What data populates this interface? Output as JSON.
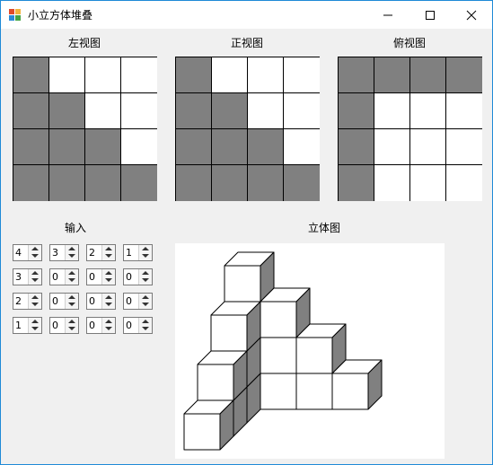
{
  "window": {
    "title": "小立方体堆叠",
    "icon": "app-icon"
  },
  "controls": {
    "minimize": "minimize-icon",
    "maximize": "maximize-icon",
    "close": "close-icon"
  },
  "views": [
    {
      "id": "left",
      "label": "左视图",
      "cells": [
        [
          1,
          0,
          0,
          0
        ],
        [
          1,
          1,
          0,
          0
        ],
        [
          1,
          1,
          1,
          0
        ],
        [
          1,
          1,
          1,
          1
        ]
      ]
    },
    {
      "id": "front",
      "label": "正视图",
      "cells": [
        [
          1,
          0,
          0,
          0
        ],
        [
          1,
          1,
          0,
          0
        ],
        [
          1,
          1,
          1,
          0
        ],
        [
          1,
          1,
          1,
          1
        ]
      ]
    },
    {
      "id": "top",
      "label": "俯视图",
      "cells": [
        [
          1,
          1,
          1,
          1
        ],
        [
          1,
          0,
          0,
          0
        ],
        [
          1,
          0,
          0,
          0
        ],
        [
          1,
          0,
          0,
          0
        ]
      ]
    }
  ],
  "input": {
    "label": "输入",
    "values": [
      [
        "4",
        "3",
        "2",
        "1"
      ],
      [
        "3",
        "0",
        "0",
        "0"
      ],
      [
        "2",
        "0",
        "0",
        "0"
      ],
      [
        "1",
        "0",
        "0",
        "0"
      ]
    ]
  },
  "stereo": {
    "label": "立体图"
  },
  "colors": {
    "filled": "#808080",
    "empty": "#ffffff",
    "cube_front": "#ffffff",
    "cube_top": "#ffffff",
    "cube_side": "#808080"
  }
}
